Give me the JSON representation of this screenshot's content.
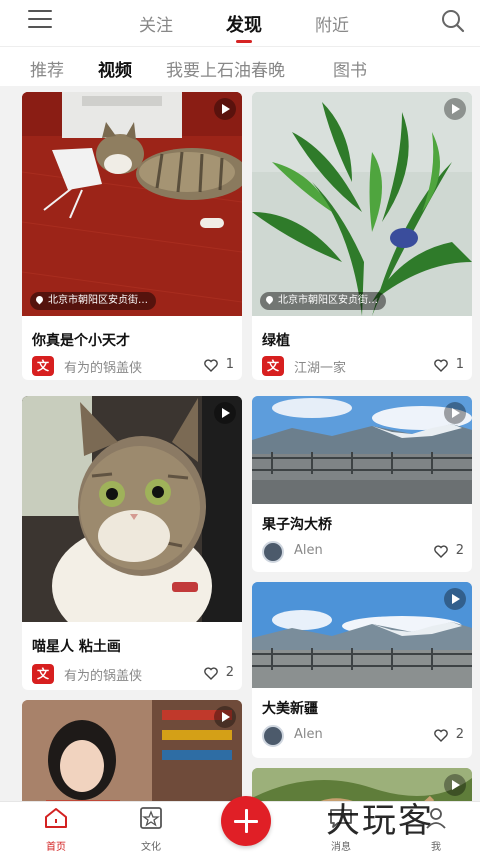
{
  "header": {
    "tabs": [
      {
        "label": "关注"
      },
      {
        "label": "发现"
      },
      {
        "label": "附近"
      }
    ],
    "active_tab": "发现"
  },
  "subnav": {
    "tabs": [
      {
        "label": "推荐"
      },
      {
        "label": "视频"
      },
      {
        "label": "我要上石油春晚"
      },
      {
        "label": "图书"
      }
    ],
    "active_tab": "视频"
  },
  "feed": {
    "cards": [
      {
        "title": "你真是个小天才",
        "location": "北京市朝阳区安贞街…",
        "author": "有为的锅盖侠",
        "badge": "文",
        "likes": "1",
        "thumb": "cat-on-red-floor"
      },
      {
        "title": "绿植",
        "location": "北京市朝阳区安贞街…",
        "author": "江湖一家",
        "badge": "文",
        "likes": "1",
        "thumb": "green-plant"
      },
      {
        "title": "喵星人 粘土画",
        "location": "",
        "author": "有为的锅盖侠",
        "badge": "文",
        "likes": "2",
        "thumb": "surprised-cat"
      },
      {
        "title": "果子沟大桥",
        "location": "",
        "author": "Alen",
        "badge": "",
        "likes": "2",
        "thumb": "mountain-bridge"
      },
      {
        "title": "大美新疆",
        "location": "",
        "author": "Alen",
        "badge": "",
        "likes": "2",
        "thumb": "mountain-bridge-2"
      },
      {
        "title": "",
        "location": "",
        "author": "",
        "badge": "",
        "likes": "",
        "thumb": "girl-portrait"
      },
      {
        "title": "",
        "location": "",
        "author": "",
        "badge": "",
        "likes": "",
        "thumb": "plant-closeup"
      }
    ]
  },
  "bottom_nav": {
    "items": [
      {
        "label": "首页",
        "icon": "home-icon"
      },
      {
        "label": "文化",
        "icon": "culture-icon"
      },
      {
        "label": "消息",
        "icon": "message-icon"
      },
      {
        "label": "我",
        "icon": "profile-icon"
      }
    ],
    "active": "首页"
  },
  "watermark": "大玩客",
  "colors": {
    "accent": "#d62424",
    "fab": "#e01f26"
  }
}
